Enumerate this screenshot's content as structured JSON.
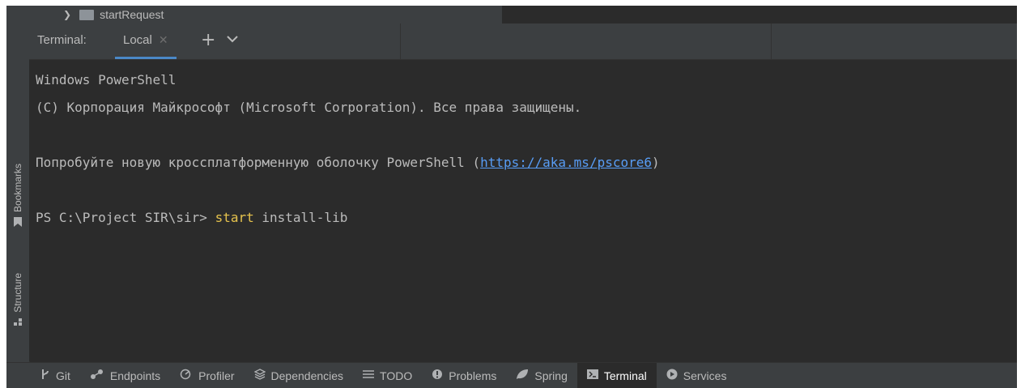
{
  "tree": {
    "item_label": "startRequest"
  },
  "sidebar": {
    "bookmarks_label": "Bookmarks",
    "structure_label": "Structure"
  },
  "terminal": {
    "caption": "Terminal:",
    "tab_label": "Local",
    "lines": {
      "l1": "Windows PowerShell",
      "l2": "(C) Корпорация Майкрософт (Microsoft Corporation). Все права защищены.",
      "l3_prefix": "Попробуйте новую кроссплатформенную оболочку PowerShell (",
      "l3_link": "https://aka.ms/pscore6",
      "l3_suffix": ")",
      "prompt": "PS C:\\Project SIR\\sir> ",
      "command_keyword": "start",
      "command_rest": " install-lib"
    }
  },
  "bottom_tools": {
    "git": "Git",
    "endpoints": "Endpoints",
    "profiler": "Profiler",
    "dependencies": "Dependencies",
    "todo": "TODO",
    "problems": "Problems",
    "spring": "Spring",
    "terminal": "Terminal",
    "services": "Services"
  },
  "colors": {
    "background": "#2b2b2b",
    "panel": "#3c3f41",
    "text": "#bbbbbb",
    "link": "#589df6",
    "keyword": "#e6c34d",
    "accent": "#4a88c7"
  },
  "icons": {
    "tree_chevron": "chevron-right-icon",
    "folder": "folder-icon",
    "bookmark": "bookmark-icon",
    "structure": "structure-icon",
    "close": "close-icon",
    "add": "plus-icon",
    "menu": "chevron-down-icon"
  }
}
